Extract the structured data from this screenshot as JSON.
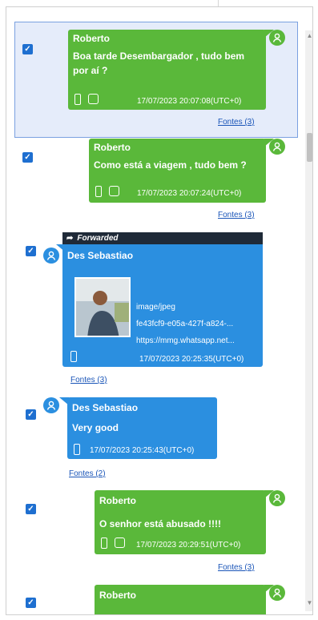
{
  "messages": [
    {
      "sender": "Roberto",
      "text_line1": "Boa tarde Desembargador , tudo bem",
      "text_line2": "por aí ?",
      "timestamp": "17/07/2023 20:07:08(UTC+0)",
      "sources": "Fontes (3)"
    },
    {
      "sender": "Roberto",
      "text": "Como está a viagem , tudo bem ?",
      "timestamp": "17/07/2023 20:07:24(UTC+0)",
      "sources": "Fontes (3)"
    },
    {
      "forwarded_label": "Forwarded",
      "sender": "Des Sebastiao",
      "attachment_type": "image/jpeg",
      "attachment_name": "fe43fcf9-e05a-427f-a824-...",
      "attachment_url": "https://mmg.whatsapp.net...",
      "timestamp": "17/07/2023 20:25:35(UTC+0)",
      "sources": "Fontes (3)"
    },
    {
      "sender": "Des Sebastiao",
      "text": "Very good",
      "timestamp": "17/07/2023 20:25:43(UTC+0)",
      "sources": "Fontes (2)"
    },
    {
      "sender": "Roberto",
      "text": "O senhor está abusado !!!!",
      "timestamp": "17/07/2023 20:29:51(UTC+0)",
      "sources": "Fontes (3)"
    },
    {
      "sender": "Roberto"
    }
  ],
  "colors": {
    "outgoing": "#5ab83a",
    "incoming": "#2b8fe0",
    "forwarded_bar": "#1f2a38",
    "selection": "#e5ecfa",
    "checkbox": "#1e6fd0",
    "link": "#1a55b8"
  }
}
